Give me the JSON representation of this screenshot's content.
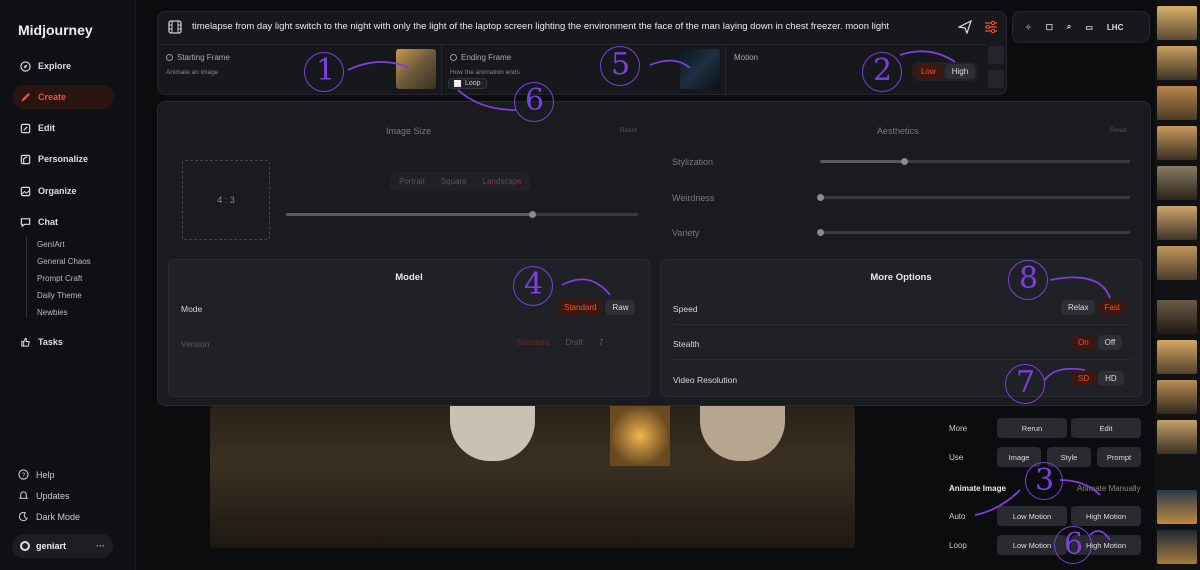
{
  "sidebar": {
    "brand": "Midjourney",
    "items": [
      {
        "label": "Explore",
        "icon": "compass-icon"
      },
      {
        "label": "Create",
        "icon": "brush-icon"
      },
      {
        "label": "Edit",
        "icon": "edit-icon"
      },
      {
        "label": "Personalize",
        "icon": "personalize-icon"
      },
      {
        "label": "Organize",
        "icon": "image-icon"
      },
      {
        "label": "Chat",
        "icon": "chat-icon"
      },
      {
        "label": "Tasks",
        "icon": "thumbs-up-icon"
      }
    ],
    "chat_rooms": [
      "GenIArt",
      "General Chaos",
      "Prompt Craft",
      "Daily Theme",
      "Newbies"
    ],
    "help": "Help",
    "updates": "Updates",
    "dark_mode": "Dark Mode",
    "user": "geniart"
  },
  "prompt": {
    "text": "timelapse from day light switch to the night with only the light of the laptop screen lighting the environment the face of the man laying down in chest freezer. moon light"
  },
  "frames": {
    "start_title": "Starting Frame",
    "start_sub": "Animate an image",
    "end_title": "Ending Frame",
    "end_sub": "How the animation ends",
    "loop": "Loop",
    "motion": "Motion",
    "low": "Low",
    "high": "High"
  },
  "topbar": {
    "user": "LHC"
  },
  "settings": {
    "image_size": "Image Size",
    "reset": "Reset",
    "ratio": "4 : 3",
    "portrait": "Portrait",
    "square": "Square",
    "landscape": "Landscape",
    "aesthetics": "Aesthetics",
    "stylization": "Stylization",
    "weirdness": "Weirdness",
    "variety": "Variety",
    "stylization_level": 0.27,
    "weirdness_level": 0.0,
    "variety_level": 0.0,
    "size_level": 0.7
  },
  "model": {
    "title": "Model",
    "mode": "Mode",
    "standard": "Standard",
    "raw": "Raw",
    "version": "Version",
    "v_standard": "Standard",
    "draft": "Draft",
    "ver": "7"
  },
  "more": {
    "title": "More Options",
    "speed": "Speed",
    "relax": "Relax",
    "fast": "Fast",
    "stealth": "Stealth",
    "on": "On",
    "off": "Off",
    "video_res": "Video Resolution",
    "sd": "SD",
    "hd": "HD"
  },
  "right_panel": {
    "more": "More",
    "rerun": "Rerun",
    "edit": "Edit",
    "use": "Use",
    "image": "Image",
    "style": "Style",
    "prompt": "Prompt",
    "animate_image": "Animate Image",
    "animate_manually": "Animate Manually",
    "auto": "Auto",
    "loop": "Loop",
    "low_motion": "Low Motion",
    "high_motion": "High Motion"
  },
  "annotations": [
    "1",
    "2",
    "3",
    "4",
    "5",
    "6",
    "6",
    "7",
    "8",
    "6"
  ],
  "colors": {
    "accent": "#ff4b2b",
    "annotation": "#7d3fe0"
  }
}
